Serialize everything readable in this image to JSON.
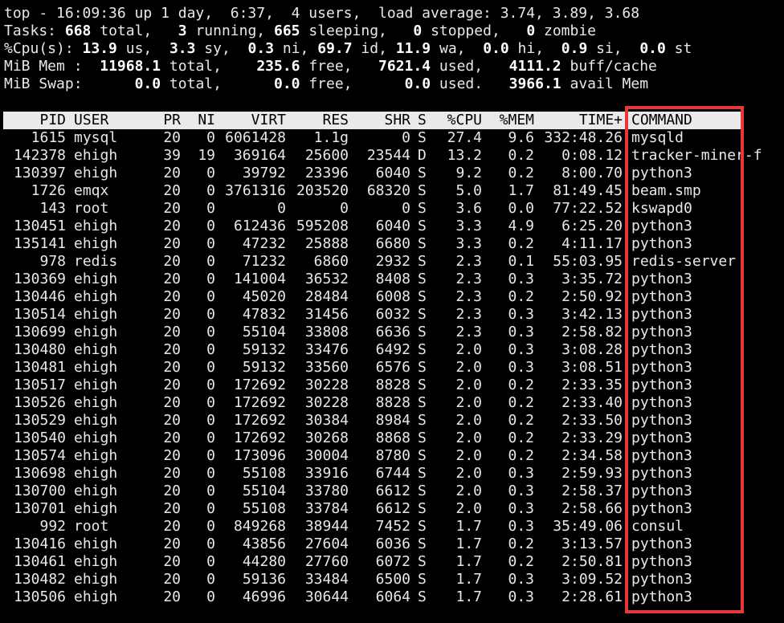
{
  "summary": {
    "line1": "top - 16:09:36 up 1 day,  6:37,  4 users,  load average: 3.74, 3.89, 3.68",
    "tasks": {
      "label": "Tasks:",
      "total": "668",
      "total_lbl": " total,",
      "running": "3",
      "running_lbl": " running,",
      "sleeping": "665",
      "sleeping_lbl": " sleeping,",
      "stopped": "0",
      "stopped_lbl": " stopped,",
      "zombie": "0",
      "zombie_lbl": " zombie"
    },
    "cpu": {
      "label": "%Cpu(s):",
      "us": "13.9",
      "us_lbl": " us,",
      "sy": "3.3",
      "sy_lbl": " sy,",
      "ni": "0.3",
      "ni_lbl": " ni,",
      "id": "69.7",
      "id_lbl": " id,",
      "wa": "11.9",
      "wa_lbl": " wa,",
      "hi": "0.0",
      "hi_lbl": " hi,",
      "si": "0.9",
      "si_lbl": " si,",
      "st": "0.0",
      "st_lbl": " st"
    },
    "mem": {
      "label": "MiB Mem :",
      "total": "11968.1",
      "total_lbl": " total,",
      "free": "235.6",
      "free_lbl": " free,",
      "used": "7621.4",
      "used_lbl": " used,",
      "buff": "4111.2",
      "buff_lbl": " buff/cache"
    },
    "swap": {
      "label": "MiB Swap:",
      "total": "0.0",
      "total_lbl": " total,",
      "free": "0.0",
      "free_lbl": " free,",
      "used": "0.0",
      "used_lbl": " used.",
      "avail": "3966.1",
      "avail_lbl": " avail Mem"
    }
  },
  "columns": {
    "pid": "PID",
    "user": "USER",
    "pr": "PR",
    "ni": "NI",
    "virt": "VIRT",
    "res": "RES",
    "shr": "SHR",
    "s": "S",
    "cpu": "%CPU",
    "mem": "%MEM",
    "time": "TIME+",
    "command": "COMMAND"
  },
  "processes": [
    [
      "1615",
      "mysql",
      "20",
      "0",
      "6061428",
      "1.1g",
      "0",
      "S",
      "27.4",
      "9.6",
      "332:48.26",
      "mysqld"
    ],
    [
      "142378",
      "ehigh",
      "39",
      "19",
      "369164",
      "25600",
      "23544",
      "D",
      "13.2",
      "0.2",
      "0:08.12",
      "tracker-miner-f"
    ],
    [
      "130397",
      "ehigh",
      "20",
      "0",
      "39792",
      "23396",
      "6040",
      "S",
      "9.2",
      "0.2",
      "8:00.70",
      "python3"
    ],
    [
      "1726",
      "emqx",
      "20",
      "0",
      "3761316",
      "203520",
      "68320",
      "S",
      "5.0",
      "1.7",
      "81:49.45",
      "beam.smp"
    ],
    [
      "143",
      "root",
      "20",
      "0",
      "0",
      "0",
      "0",
      "S",
      "3.6",
      "0.0",
      "77:22.52",
      "kswapd0"
    ],
    [
      "130451",
      "ehigh",
      "20",
      "0",
      "612436",
      "595208",
      "6040",
      "S",
      "3.3",
      "4.9",
      "6:25.20",
      "python3"
    ],
    [
      "135141",
      "ehigh",
      "20",
      "0",
      "47232",
      "25888",
      "6680",
      "S",
      "3.3",
      "0.2",
      "4:11.17",
      "python3"
    ],
    [
      "978",
      "redis",
      "20",
      "0",
      "71232",
      "6860",
      "2932",
      "S",
      "2.3",
      "0.1",
      "55:03.95",
      "redis-server"
    ],
    [
      "130369",
      "ehigh",
      "20",
      "0",
      "141004",
      "36532",
      "8408",
      "S",
      "2.3",
      "0.3",
      "3:35.72",
      "python3"
    ],
    [
      "130446",
      "ehigh",
      "20",
      "0",
      "45020",
      "28484",
      "6008",
      "S",
      "2.3",
      "0.2",
      "2:50.92",
      "python3"
    ],
    [
      "130514",
      "ehigh",
      "20",
      "0",
      "47832",
      "31456",
      "6032",
      "S",
      "2.3",
      "0.3",
      "3:42.13",
      "python3"
    ],
    [
      "130699",
      "ehigh",
      "20",
      "0",
      "55104",
      "33808",
      "6636",
      "S",
      "2.3",
      "0.3",
      "2:58.82",
      "python3"
    ],
    [
      "130480",
      "ehigh",
      "20",
      "0",
      "59132",
      "33476",
      "6492",
      "S",
      "2.0",
      "0.3",
      "3:08.28",
      "python3"
    ],
    [
      "130481",
      "ehigh",
      "20",
      "0",
      "59132",
      "33560",
      "6576",
      "S",
      "2.0",
      "0.3",
      "3:08.51",
      "python3"
    ],
    [
      "130517",
      "ehigh",
      "20",
      "0",
      "172692",
      "30228",
      "8828",
      "S",
      "2.0",
      "0.2",
      "2:33.35",
      "python3"
    ],
    [
      "130526",
      "ehigh",
      "20",
      "0",
      "172692",
      "30228",
      "8828",
      "S",
      "2.0",
      "0.2",
      "2:33.40",
      "python3"
    ],
    [
      "130529",
      "ehigh",
      "20",
      "0",
      "172692",
      "30384",
      "8984",
      "S",
      "2.0",
      "0.2",
      "2:33.50",
      "python3"
    ],
    [
      "130540",
      "ehigh",
      "20",
      "0",
      "172692",
      "30268",
      "8868",
      "S",
      "2.0",
      "0.2",
      "2:33.29",
      "python3"
    ],
    [
      "130574",
      "ehigh",
      "20",
      "0",
      "173096",
      "30004",
      "8780",
      "S",
      "2.0",
      "0.2",
      "2:34.58",
      "python3"
    ],
    [
      "130698",
      "ehigh",
      "20",
      "0",
      "55108",
      "33916",
      "6744",
      "S",
      "2.0",
      "0.3",
      "2:59.93",
      "python3"
    ],
    [
      "130700",
      "ehigh",
      "20",
      "0",
      "55104",
      "33780",
      "6612",
      "S",
      "2.0",
      "0.3",
      "2:58.37",
      "python3"
    ],
    [
      "130701",
      "ehigh",
      "20",
      "0",
      "55108",
      "33784",
      "6612",
      "S",
      "2.0",
      "0.3",
      "2:58.66",
      "python3"
    ],
    [
      "992",
      "root",
      "20",
      "0",
      "849268",
      "38944",
      "7452",
      "S",
      "1.7",
      "0.3",
      "35:49.06",
      "consul"
    ],
    [
      "130416",
      "ehigh",
      "20",
      "0",
      "43856",
      "27604",
      "6036",
      "S",
      "1.7",
      "0.2",
      "3:13.57",
      "python3"
    ],
    [
      "130461",
      "ehigh",
      "20",
      "0",
      "44280",
      "27760",
      "6072",
      "S",
      "1.7",
      "0.2",
      "2:50.81",
      "python3"
    ],
    [
      "130482",
      "ehigh",
      "20",
      "0",
      "59136",
      "33484",
      "6500",
      "S",
      "1.7",
      "0.3",
      "3:09.52",
      "python3"
    ],
    [
      "130506",
      "ehigh",
      "20",
      "0",
      "46996",
      "30644",
      "6064",
      "S",
      "1.7",
      "0.3",
      "2:28.61",
      "python3"
    ]
  ],
  "colors": {
    "background": "#000000",
    "text": "#e8e8e8",
    "header_bg": "#eaeaea",
    "highlight_border": "#e53935"
  }
}
